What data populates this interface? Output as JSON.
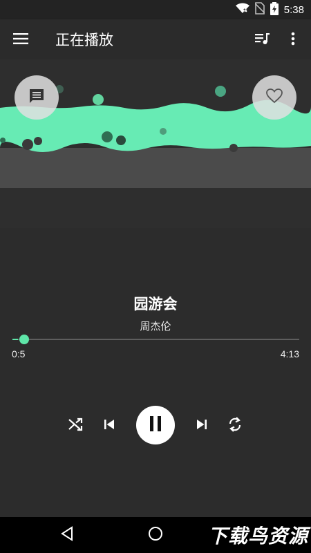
{
  "status_bar": {
    "time": "5:38",
    "icons": [
      "wifi-x-icon",
      "no-sim-icon",
      "battery-charging-icon"
    ]
  },
  "app_bar": {
    "title": "正在播放",
    "icons": [
      "menu-icon",
      "queue-music-icon",
      "more-vert-icon"
    ]
  },
  "visualizer": {
    "accent_color": "#5fe6a9",
    "buttons": [
      "comment-icon",
      "heart-icon"
    ]
  },
  "now_playing": {
    "title": "园游会",
    "artist": "周杰伦",
    "elapsed": "0:5",
    "duration": "4:13",
    "progress_fraction": 0.02
  },
  "controls": {
    "icons": [
      "shuffle-icon",
      "skip-previous-icon",
      "pause-icon",
      "skip-next-icon",
      "repeat-icon"
    ]
  },
  "nav_bar": {
    "icons": [
      "back-icon",
      "home-icon"
    ],
    "watermark": "下载鸟资源"
  }
}
